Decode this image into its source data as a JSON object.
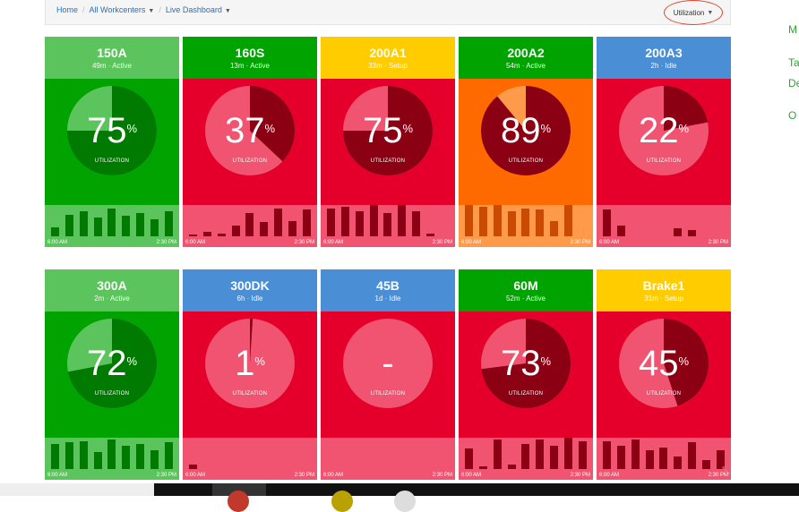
{
  "breadcrumb": {
    "home": "Home",
    "workcenters": "All Workcenters",
    "dashboard": "Live Dashboard"
  },
  "metric_dropdown": "Utilization",
  "side_links": [
    "M",
    "Ta",
    "De",
    "O"
  ],
  "colors": {
    "active_green": "#00a300",
    "active_light": "#5cc45c",
    "setup_yellow": "#ffcc00",
    "idle_blue": "#4a8fd6",
    "alarm_red": "#e5002b",
    "alarm_light": "#f05470",
    "orange": "#ff6a00",
    "dark_red": "#8b0013",
    "dark_green": "#007a00"
  },
  "cards": [
    {
      "name": "150A",
      "status": "49m · Active",
      "value": "75",
      "fraction": 0.75,
      "util_label": "UTILIZATION",
      "theme": "green",
      "head": "#5cc45c",
      "bars": [
        0.3,
        0.7,
        0.8,
        0.6,
        0.9,
        0.65,
        0.75,
        0.55,
        0.8
      ],
      "start": "6:00 AM",
      "end": "2:30 PM"
    },
    {
      "name": "160S",
      "status": "13m · Active",
      "value": "37",
      "fraction": 0.37,
      "util_label": "UTILIZATION",
      "theme": "red",
      "head": "#00a300",
      "bars": [
        0.05,
        0.15,
        0.1,
        0.35,
        0.75,
        0.45,
        0.9,
        0.5,
        0.85
      ],
      "start": "6:00 AM",
      "end": "2:30 PM"
    },
    {
      "name": "200A1",
      "status": "33m · Setup",
      "value": "75",
      "fraction": 0.75,
      "util_label": "UTILIZATION",
      "theme": "red",
      "head": "#ffcc00",
      "bars": [
        0.9,
        0.95,
        0.8,
        1.0,
        0.75,
        1.0,
        0.8,
        0.1,
        0.0
      ],
      "start": "6:00 AM",
      "end": "2:30 PM"
    },
    {
      "name": "200A2",
      "status": "54m · Active",
      "value": "89",
      "fraction": 0.89,
      "util_label": "UTILIZATION",
      "theme": "orange",
      "head": "#00a300",
      "bars": [
        1.0,
        0.95,
        1.0,
        0.8,
        0.9,
        0.85,
        0.5,
        1.0,
        0.0
      ],
      "start": "6:00 AM",
      "end": "2:30 PM"
    },
    {
      "name": "200A3",
      "status": "2h · Idle",
      "value": "22",
      "fraction": 0.22,
      "util_label": "UTILIZATION",
      "theme": "red",
      "head": "#4a8fd6",
      "bars": [
        0.85,
        0.35,
        0.0,
        0.0,
        0.0,
        0.25,
        0.2,
        0.0,
        0.0
      ],
      "start": "6:00 AM",
      "end": "2:30 PM"
    },
    {
      "name": "300A",
      "status": "2m · Active",
      "value": "72",
      "fraction": 0.72,
      "util_label": "UTILIZATION",
      "theme": "green",
      "head": "#5cc45c",
      "bars": [
        0.8,
        0.85,
        0.9,
        0.55,
        0.95,
        0.75,
        0.8,
        0.6,
        0.85
      ],
      "start": "6:00 AM",
      "end": "2:30 PM"
    },
    {
      "name": "300DK",
      "status": "6h · Idle",
      "value": "1",
      "fraction": 0.01,
      "util_label": "UTILIZATION",
      "theme": "red",
      "head": "#4a8fd6",
      "bars": [
        0.15,
        0,
        0,
        0,
        0,
        0,
        0,
        0,
        0
      ],
      "start": "6:00 AM",
      "end": "2:30 PM"
    },
    {
      "name": "45B",
      "status": "1d · Idle",
      "value": "-",
      "fraction": 0.0,
      "util_label": "UTILIZATION",
      "theme": "red",
      "head": "#4a8fd6",
      "bars": [
        0,
        0,
        0,
        0,
        0,
        0,
        0,
        0,
        0
      ],
      "start": "6:00 AM",
      "end": "2:30 PM"
    },
    {
      "name": "60M",
      "status": "52m · Active",
      "value": "73",
      "fraction": 0.73,
      "util_label": "UTILIZATION",
      "theme": "red",
      "head": "#00a300",
      "bars": [
        0.65,
        0.1,
        0.95,
        0.15,
        0.8,
        0.95,
        0.75,
        1.0,
        0.9
      ],
      "start": "6:00 AM",
      "end": "2:30 PM"
    },
    {
      "name": "Brake1",
      "status": "31m · Setup",
      "value": "45",
      "fraction": 0.45,
      "util_label": "UTILIZATION",
      "theme": "red",
      "head": "#ffcc00",
      "bars": [
        0.9,
        0.75,
        0.95,
        0.6,
        0.7,
        0.4,
        0.85,
        0.3,
        0.6
      ],
      "start": "6:00 AM",
      "end": "2:30 PM"
    }
  ]
}
